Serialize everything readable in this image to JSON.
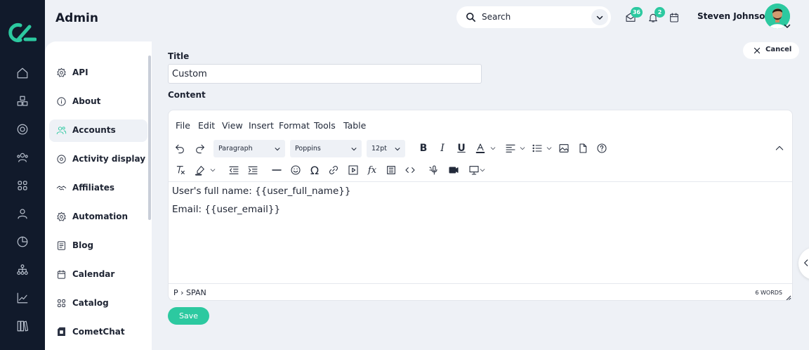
{
  "app": {
    "title": "Admin",
    "accent_color": "#2cc9a0",
    "rail_color": "#111a2b"
  },
  "header": {
    "search_label": "Search",
    "mail_count": "36",
    "notification_count": "2",
    "user_name": "Steven Johnson"
  },
  "rail": {
    "icons": [
      "home-icon",
      "boxes-icon",
      "target-icon",
      "users-icon",
      "grid-icon",
      "user-icon",
      "pie-chart-icon",
      "hierarchy-icon",
      "trend-chart-icon",
      "library-icon"
    ]
  },
  "sidebar": {
    "items": [
      {
        "label": "API",
        "icon": "gear-icon"
      },
      {
        "label": "About",
        "icon": "info-icon"
      },
      {
        "label": "Accounts",
        "icon": "users-icon",
        "active": true
      },
      {
        "label": "Activity display",
        "icon": "target-icon"
      },
      {
        "label": "Affiliates",
        "icon": "handshake-icon"
      },
      {
        "label": "Automation",
        "icon": "gear-icon"
      },
      {
        "label": "Blog",
        "icon": "document-icon"
      },
      {
        "label": "Calendar",
        "icon": "calendar-icon"
      },
      {
        "label": "Catalog",
        "icon": "grid-icon"
      },
      {
        "label": "CometChat",
        "icon": "chat-icon"
      }
    ]
  },
  "form": {
    "cancel_label": "Cancel",
    "title_label": "Title",
    "title_value": "Custom",
    "content_label": "Content",
    "save_label": "Save"
  },
  "editor": {
    "menu": [
      "File",
      "Edit",
      "View",
      "Insert",
      "Format",
      "Tools",
      "Table"
    ],
    "block_format": "Paragraph",
    "font_family": "Poppins",
    "font_size": "12pt",
    "content_lines": [
      "User's full name: {{user_full_name}}",
      "Email: {{user_email}}"
    ],
    "status_path": "P › SPAN",
    "word_count": "6 WORDS"
  }
}
